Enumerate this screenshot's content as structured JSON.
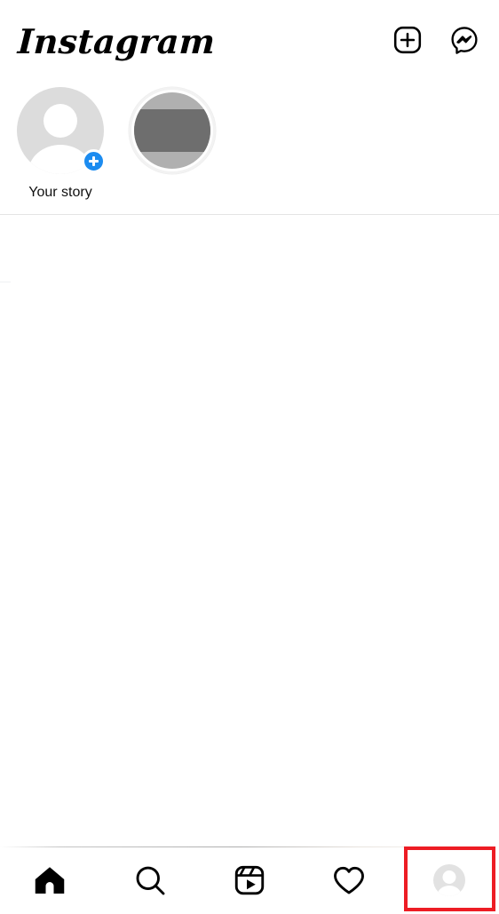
{
  "app": {
    "name": "Instagram",
    "screen": "home-feed",
    "background_color": "#ffffff"
  },
  "header": {
    "logo_text": "Instagram",
    "actions": [
      {
        "name": "new-post-button",
        "icon": "plus-square-icon",
        "label": "New post"
      },
      {
        "name": "messenger-button",
        "icon": "messenger-icon",
        "label": "Messenger"
      }
    ]
  },
  "stories": {
    "items": [
      {
        "label": "Your story",
        "type": "own-story",
        "avatar": "default-person-avatar",
        "avatar_color": "#dcdcdc",
        "has_add_badge": true,
        "badge_color": "#1c8cf0",
        "has_unseen_ring": false
      },
      {
        "label": "",
        "type": "friend-story",
        "avatar": "photo-avatar-redacted",
        "avatar_color": "#b0b0b0",
        "redaction_color": "#6e6e6e",
        "has_add_badge": false,
        "has_unseen_ring": true,
        "ring_color": "#f2f2f2"
      }
    ]
  },
  "feed": {
    "state": "empty",
    "posts": []
  },
  "bottom_nav": {
    "items": [
      {
        "name": "nav-home",
        "icon": "home-icon",
        "label": "Home",
        "active": true
      },
      {
        "name": "nav-search",
        "icon": "search-icon",
        "label": "Search",
        "active": false
      },
      {
        "name": "nav-reels",
        "icon": "reels-icon",
        "label": "Reels",
        "active": false
      },
      {
        "name": "nav-activity",
        "icon": "heart-icon",
        "label": "Activity",
        "active": false
      },
      {
        "name": "nav-profile",
        "icon": "profile-avatar",
        "label": "Profile",
        "active": false,
        "highlighted": true
      }
    ]
  },
  "annotation": {
    "type": "highlight-rectangle",
    "target": "nav-profile",
    "color": "#ed1c24",
    "stroke_width": 4
  }
}
